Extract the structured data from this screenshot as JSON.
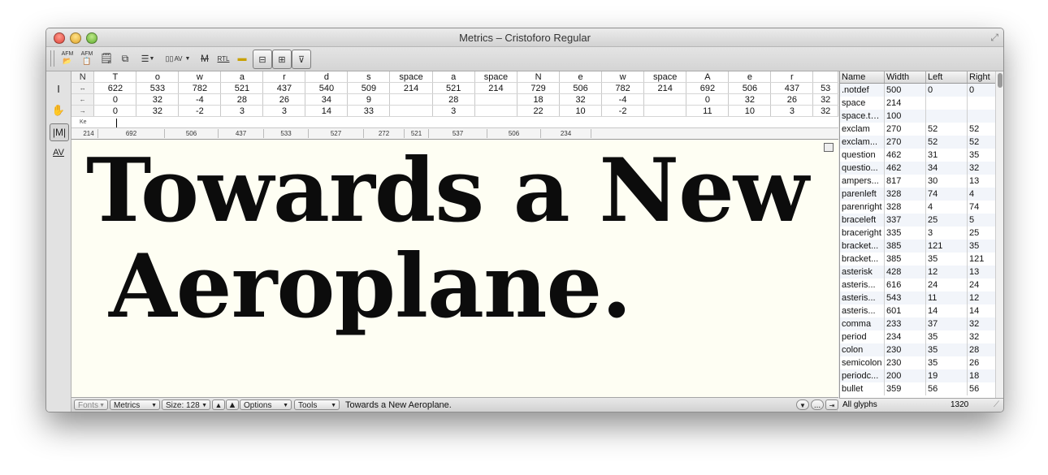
{
  "window": {
    "title": "Metrics – Cristoforo Regular"
  },
  "toolbar": {
    "buttons": [
      {
        "name": "open-afm-button",
        "label": "AFM"
      },
      {
        "name": "save-afm-button",
        "label": "AFM"
      },
      {
        "name": "paste-button",
        "label": ""
      },
      {
        "name": "kerning-layers-button",
        "label": ""
      },
      {
        "name": "classes-button",
        "label": ""
      },
      {
        "name": "kerning-av-button",
        "label": "AV"
      },
      {
        "name": "metrics-m-button",
        "label": "M"
      },
      {
        "name": "rtl-button",
        "label": "RTL"
      },
      {
        "name": "highlight-button",
        "label": ""
      },
      {
        "name": "view-mode-1-button",
        "label": ""
      },
      {
        "name": "view-mode-2-button",
        "label": ""
      },
      {
        "name": "view-mode-3-button",
        "label": ""
      }
    ]
  },
  "metrics_table": {
    "row_headers": [
      "N",
      "↔",
      "←",
      "→"
    ],
    "glyphs": [
      "T",
      "o",
      "w",
      "a",
      "r",
      "d",
      "s",
      "space",
      "a",
      "space",
      "N",
      "e",
      "w",
      "space",
      "A",
      "e",
      "r",
      ""
    ],
    "widths": [
      "622",
      "533",
      "782",
      "521",
      "437",
      "540",
      "509",
      "214",
      "521",
      "214",
      "729",
      "506",
      "782",
      "214",
      "692",
      "506",
      "437",
      "53"
    ],
    "lsb": [
      "0",
      "32",
      "-4",
      "28",
      "26",
      "34",
      "9",
      "",
      "28",
      "",
      "18",
      "32",
      "-4",
      "",
      "0",
      "32",
      "26",
      "32"
    ],
    "rsb": [
      "0",
      "32",
      "-2",
      "3",
      "3",
      "14",
      "33",
      "",
      "3",
      "",
      "22",
      "10",
      "-2",
      "",
      "11",
      "10",
      "3",
      "32"
    ],
    "kern_label": "Ke"
  },
  "ruler": {
    "values": [
      "214",
      "692",
      "506",
      "437",
      "533",
      "527",
      "272",
      "521",
      "537",
      "506",
      "234"
    ]
  },
  "preview": {
    "line1": "Towards a New",
    "line2": "Aeroplane."
  },
  "bottombar": {
    "fonts": "Fonts",
    "metrics": "Metrics",
    "size": "Size: 128",
    "options": "Options",
    "tools": "Tools",
    "text": "Towards a New Aeroplane.",
    "ellipsis": "..."
  },
  "glyph_table": {
    "headers": [
      "Name",
      "Width",
      "Left",
      "Right"
    ],
    "rows": [
      [
        ".notdef",
        "500",
        "0",
        "0"
      ],
      [
        "space",
        "214",
        "",
        ""
      ],
      [
        "space.thin",
        "100",
        "",
        ""
      ],
      [
        "exclam",
        "270",
        "52",
        "52"
      ],
      [
        "exclam...",
        "270",
        "52",
        "52"
      ],
      [
        "question",
        "462",
        "31",
        "35"
      ],
      [
        "questio...",
        "462",
        "34",
        "32"
      ],
      [
        "ampers...",
        "817",
        "30",
        "13"
      ],
      [
        "parenleft",
        "328",
        "74",
        "4"
      ],
      [
        "parenright",
        "328",
        "4",
        "74"
      ],
      [
        "braceleft",
        "337",
        "25",
        "5"
      ],
      [
        "braceright",
        "335",
        "3",
        "25"
      ],
      [
        "bracket...",
        "385",
        "121",
        "35"
      ],
      [
        "bracket...",
        "385",
        "35",
        "121"
      ],
      [
        "asterisk",
        "428",
        "12",
        "13"
      ],
      [
        "asteris...",
        "616",
        "24",
        "24"
      ],
      [
        "asteris...",
        "543",
        "11",
        "12"
      ],
      [
        "asteris...",
        "601",
        "14",
        "14"
      ],
      [
        "comma",
        "233",
        "37",
        "32"
      ],
      [
        "period",
        "234",
        "35",
        "32"
      ],
      [
        "colon",
        "230",
        "35",
        "28"
      ],
      [
        "semicolon",
        "230",
        "35",
        "26"
      ],
      [
        "periodc...",
        "200",
        "19",
        "18"
      ],
      [
        "bullet",
        "359",
        "56",
        "56"
      ]
    ],
    "filter": "All glyphs",
    "count": "1320"
  }
}
